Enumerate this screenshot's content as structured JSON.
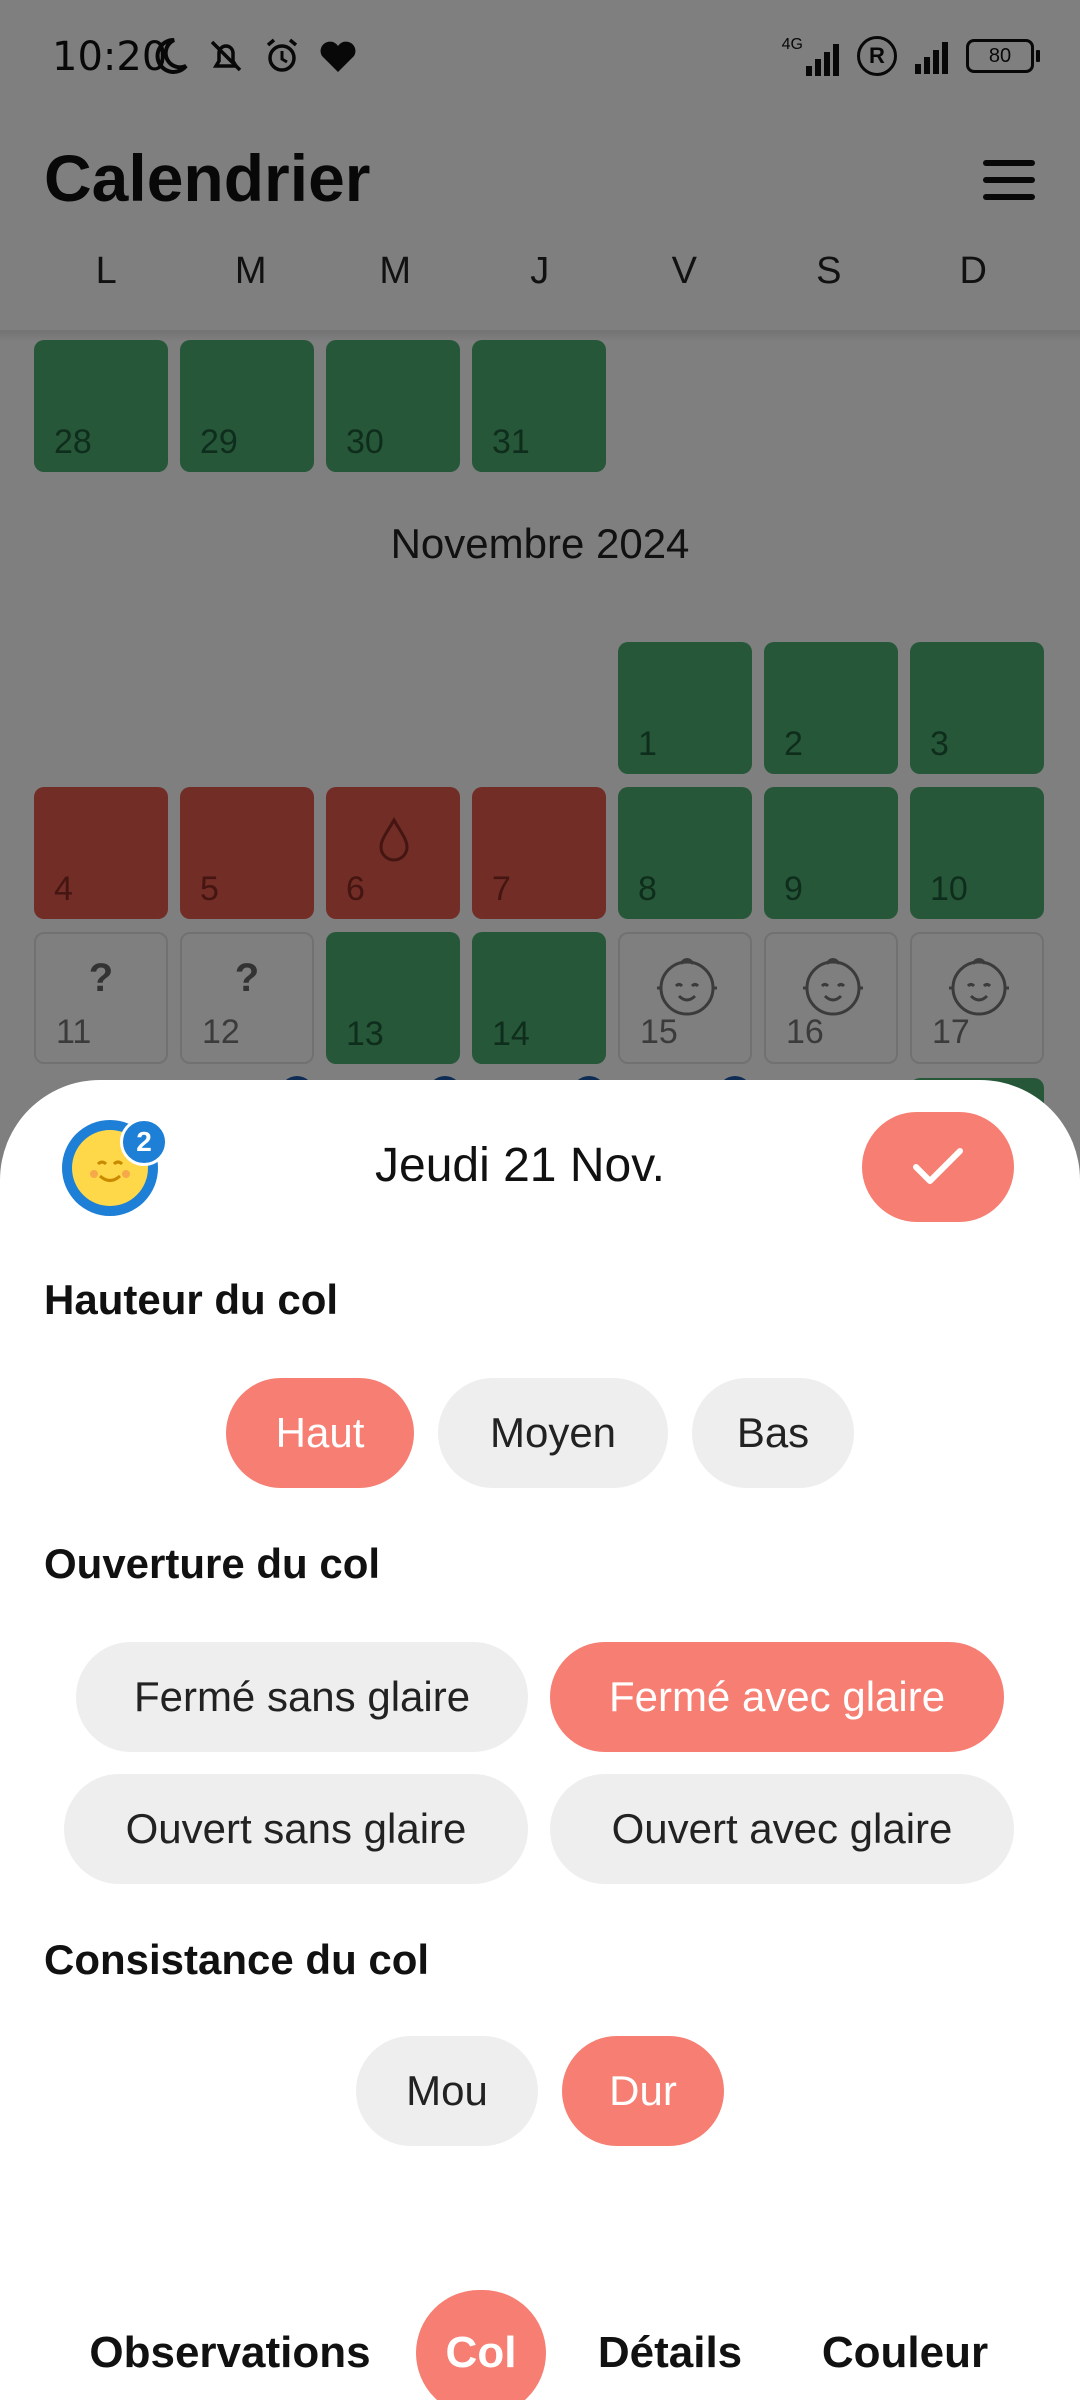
{
  "status_bar": {
    "time": "10:20",
    "network": "4G",
    "roaming": "R",
    "battery": "80"
  },
  "header": {
    "title": "Calendrier",
    "weekdays": [
      "L",
      "M",
      "M",
      "J",
      "V",
      "S",
      "D"
    ]
  },
  "calendar": {
    "october_tail": [
      {
        "day": "28",
        "state": "green"
      },
      {
        "day": "29",
        "state": "green"
      },
      {
        "day": "30",
        "state": "green"
      },
      {
        "day": "31",
        "state": "green"
      }
    ],
    "month_title": "Novembre 2024",
    "november_weeks": [
      [
        {
          "day": "1",
          "state": "green"
        },
        {
          "day": "2",
          "state": "green"
        },
        {
          "day": "3",
          "state": "green"
        }
      ],
      [
        {
          "day": "4",
          "state": "red"
        },
        {
          "day": "5",
          "state": "red"
        },
        {
          "day": "6",
          "state": "red",
          "icon": "drop-icon"
        },
        {
          "day": "7",
          "state": "red"
        },
        {
          "day": "8",
          "state": "green"
        },
        {
          "day": "9",
          "state": "green"
        },
        {
          "day": "10",
          "state": "green"
        }
      ],
      [
        {
          "day": "11",
          "state": "empty",
          "mark": "?"
        },
        {
          "day": "12",
          "state": "empty",
          "mark": "?"
        },
        {
          "day": "13",
          "state": "green"
        },
        {
          "day": "14",
          "state": "green"
        },
        {
          "day": "15",
          "state": "empty",
          "icon": "baby-face-icon"
        },
        {
          "day": "16",
          "state": "empty",
          "icon": "baby-face-icon"
        },
        {
          "day": "17",
          "state": "empty",
          "icon": "baby-face-icon"
        }
      ]
    ]
  },
  "sheet": {
    "badge_count": "2",
    "date": "Jeudi 21 Nov.",
    "sections": {
      "hauteur": {
        "title": "Hauteur du col",
        "options": [
          "Haut",
          "Moyen",
          "Bas"
        ],
        "selected": "Haut"
      },
      "ouverture": {
        "title": "Ouverture du col",
        "options": [
          "Fermé sans glaire",
          "Fermé avec glaire",
          "Ouvert sans glaire",
          "Ouvert avec glaire"
        ],
        "selected": "Fermé avec glaire"
      },
      "consistance": {
        "title": "Consistance du col",
        "options": [
          "Mou",
          "Dur"
        ],
        "selected": "Dur"
      }
    },
    "tabs": [
      "Observations",
      "Col",
      "Détails",
      "Couleur"
    ],
    "active_tab": "Col"
  },
  "colors": {
    "accent": "#f77e72",
    "green": "#4caf72",
    "red": "#e25a4c",
    "avatar_blue": "#1e7fd6"
  }
}
